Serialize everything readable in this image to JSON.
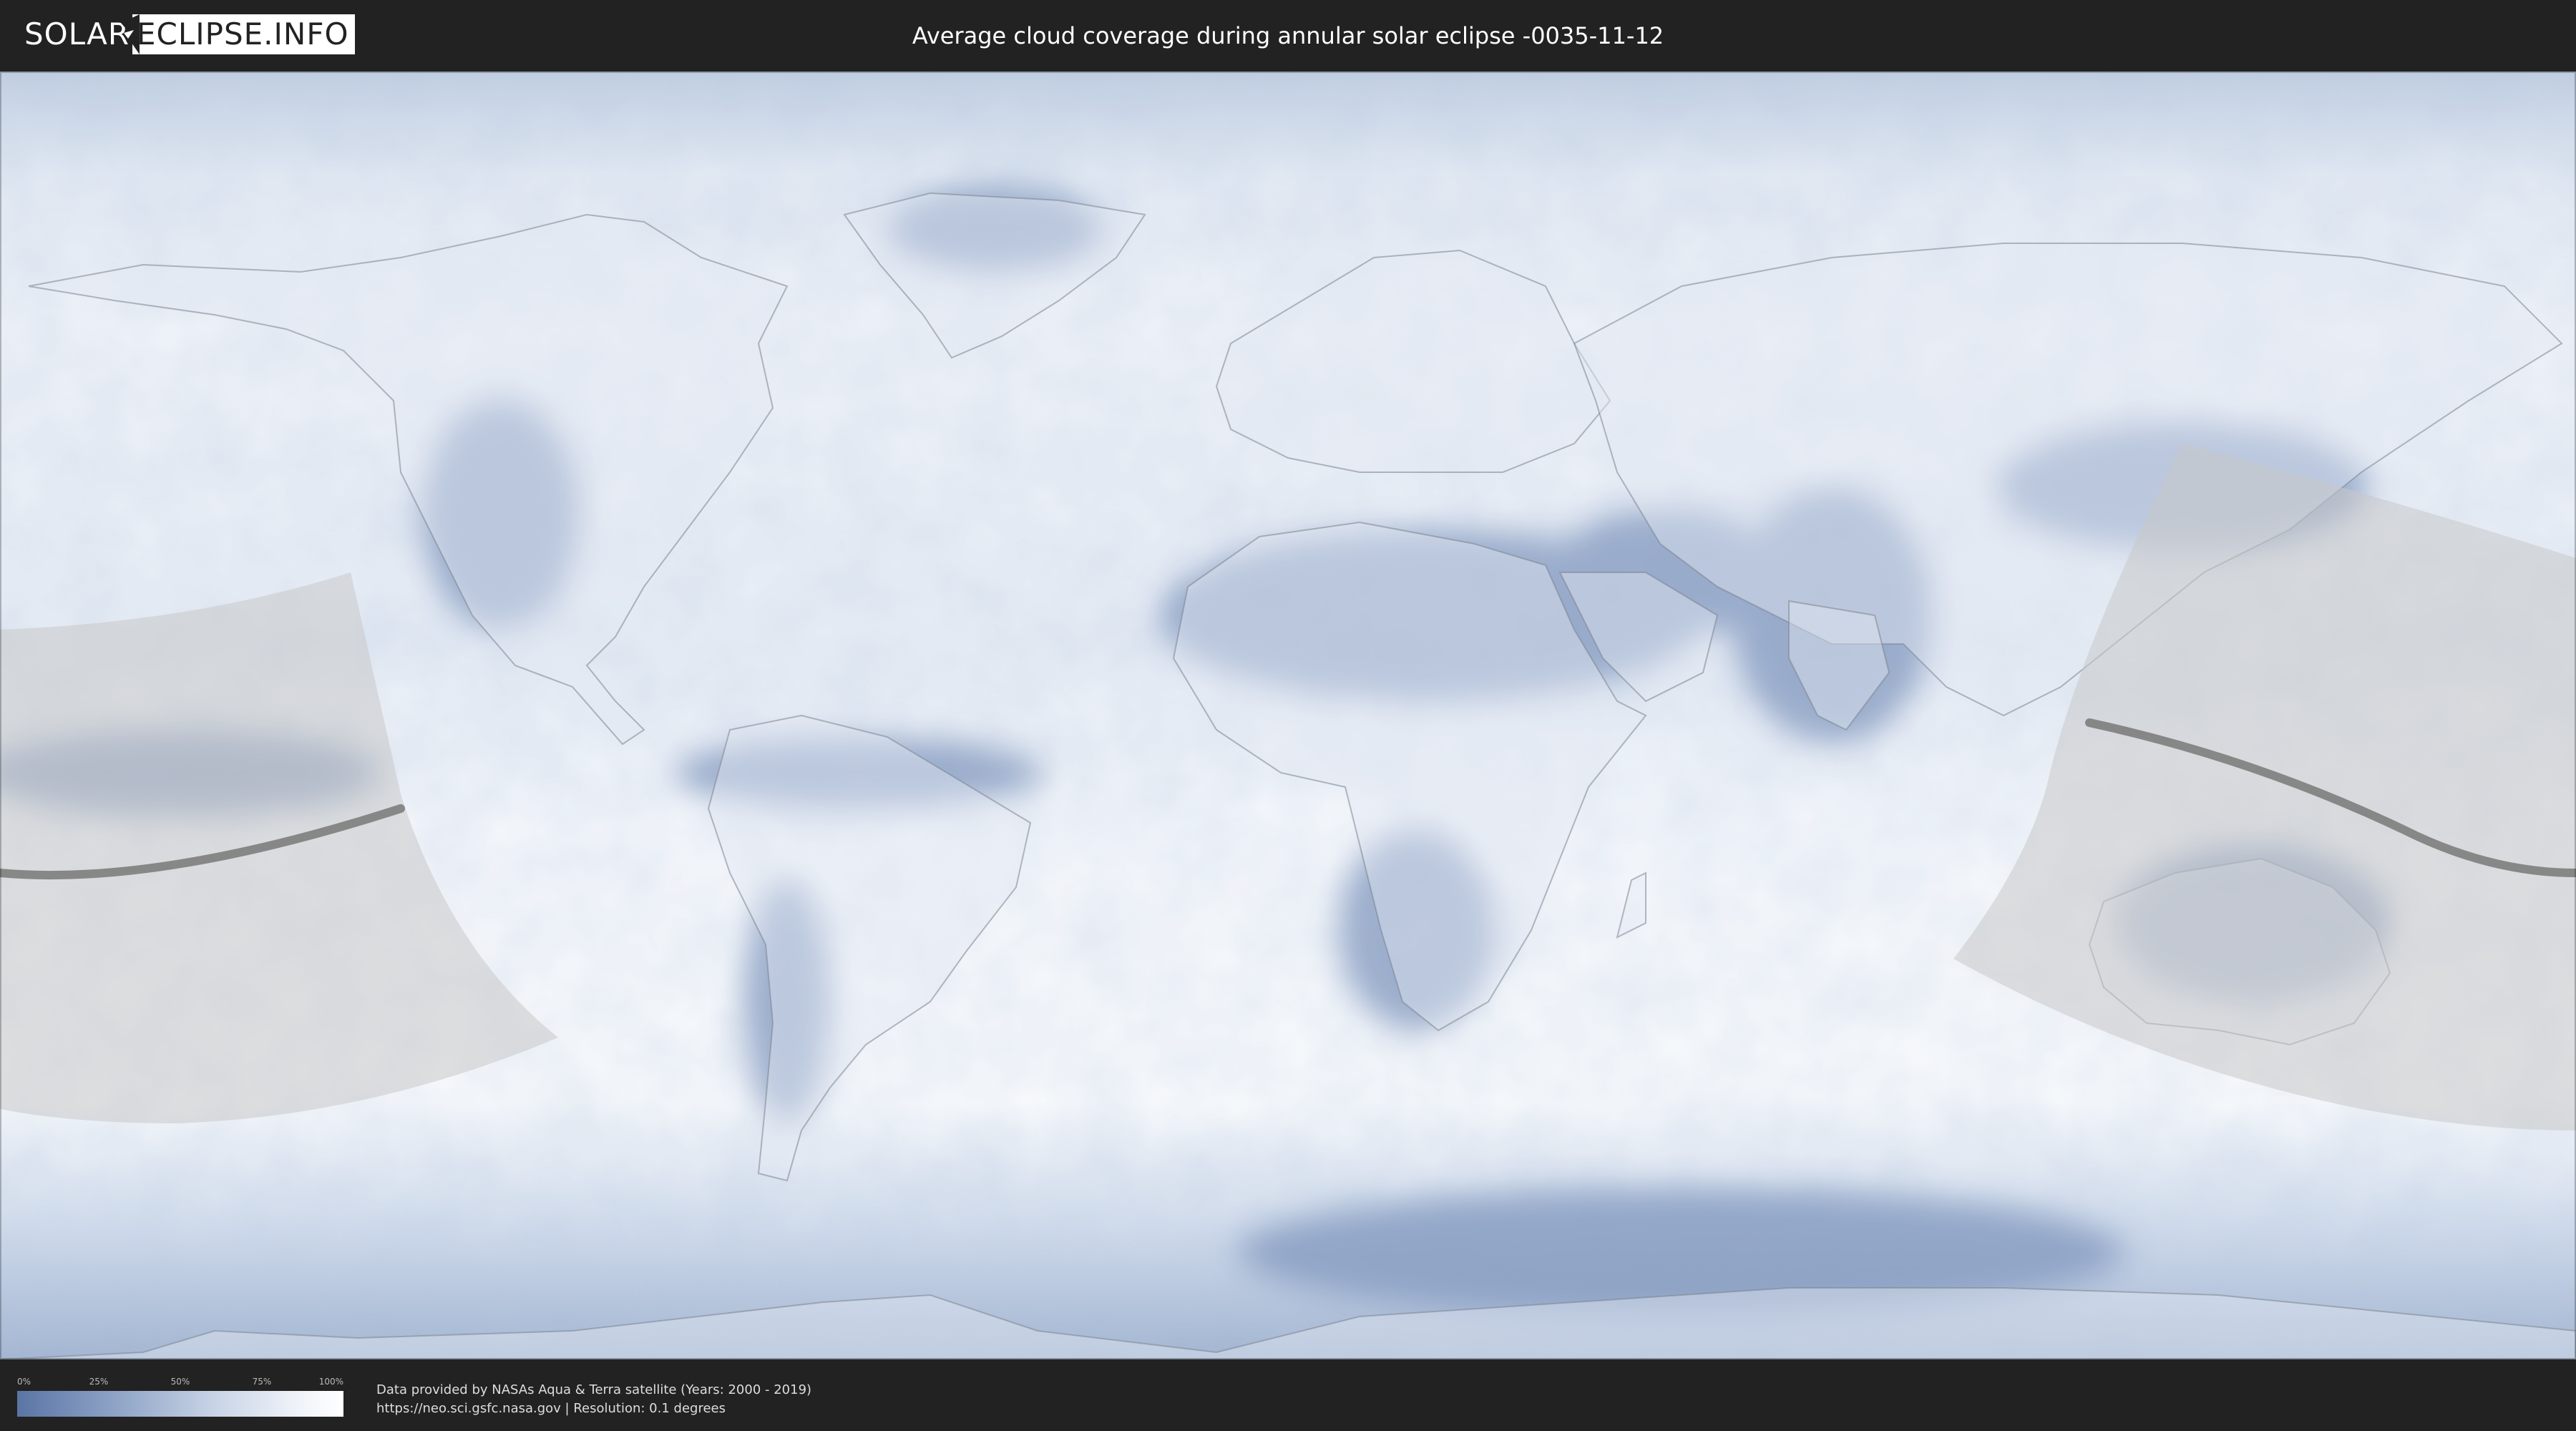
{
  "header": {
    "logo_left": "SOLAR",
    "logo_right": "ECLIPSE.INFO",
    "title": "Average cloud coverage during annular solar eclipse -0035-11-12"
  },
  "map": {
    "projection": "equirectangular",
    "background_color": "#f2f5fa",
    "cloud_color": "#6b86b3",
    "visibility_zone_color": "#c8c8c8",
    "central_line_color": "#777777"
  },
  "legend": {
    "ticks": [
      "0%",
      "25%",
      "50%",
      "75%",
      "100%"
    ],
    "gradient_start": "#5a75a5",
    "gradient_end": "#ffffff"
  },
  "footer": {
    "credit_line_1": "Data provided by NASAs Aqua & Terra satellite (Years: 2000 - 2019)",
    "credit_line_2": "https://neo.sci.gsfc.nasa.gov | Resolution: 0.1 degrees"
  }
}
